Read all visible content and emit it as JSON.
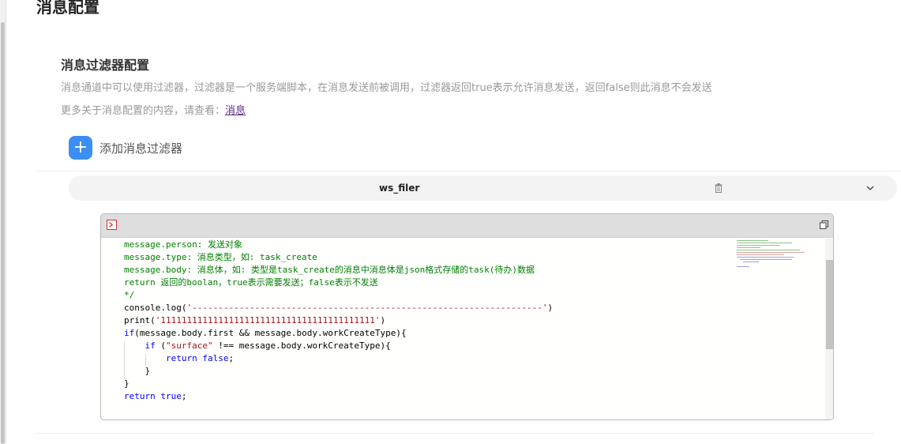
{
  "page": {
    "title": "消息配置"
  },
  "section": {
    "title": "消息过滤器配置",
    "description": "消息通道中可以使用过滤器，过滤器是一个服务端脚本，在消息发送前被调用，过滤器返回true表示允许消息发送，返回false则此消息不会发送",
    "more_prefix": "更多关于消息配置的内容，请查看：",
    "more_link": "消息"
  },
  "add_filter": {
    "icon": "+",
    "label": "添加消息过滤器"
  },
  "filter": {
    "name": "ws_filer"
  },
  "colors": {
    "accent": "#3b8ef3",
    "comment": "#008000",
    "keyword": "#0000ff",
    "string": "#a31515"
  },
  "icons": {
    "add": "plus-icon",
    "delete": "trash-icon",
    "expand": "chevron-down-icon",
    "editor_mode": "script-icon",
    "restore": "restore-window-icon"
  },
  "code": {
    "lines": [
      "message.person: 发送对象",
      "message.type: 消息类型，如: task_create",
      "message.body: 消息体，如: 类型是task_create的消息中消息体是json格式存储的task(待办)数据",
      "return 返回的boolan，true表示需要发送；false表示不发送",
      "*/",
      "console.log('-------------------------------------------------------------------')",
      "print('11111111111111111111111111111111111111111')",
      "if(message.body.first && message.body.workCreateType){",
      "    if (\"surface\" !== message.body.workCreateType){",
      "        return false;",
      "    }",
      "}",
      "return true;"
    ]
  }
}
